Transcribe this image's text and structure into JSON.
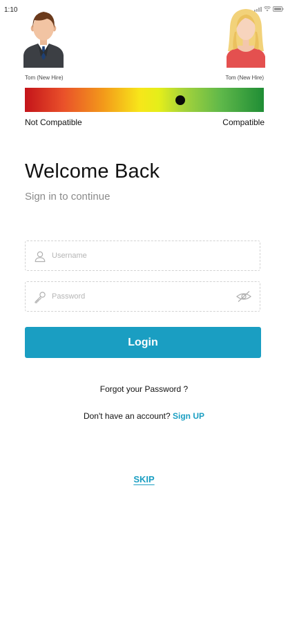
{
  "status_bar": {
    "time": "1:10"
  },
  "profiles": {
    "left": {
      "name": "Tom (New Hire)",
      "icon": "male-avatar-icon"
    },
    "right": {
      "name": "Tom (New Hire)",
      "icon": "female-avatar-icon"
    }
  },
  "compatibility": {
    "left_label": "Not Compatible",
    "right_label": "Compatible",
    "score_fraction": 0.65,
    "colors": [
      "#c4141a",
      "#f39a1a",
      "#f7e61a",
      "#5fb84a",
      "#1f8d35"
    ]
  },
  "welcome": {
    "title": "Welcome Back",
    "subtitle": "Sign in to continue"
  },
  "form": {
    "username_placeholder": "Username",
    "username_value": "",
    "password_placeholder": "Password",
    "password_value": "",
    "login_label": "Login"
  },
  "links": {
    "forgot": "Forgot your Password ?",
    "no_account": "Don't have an account?",
    "signup": "Sign UP",
    "skip": "SKIP"
  },
  "theme": {
    "accent": "#1a9ec2"
  }
}
